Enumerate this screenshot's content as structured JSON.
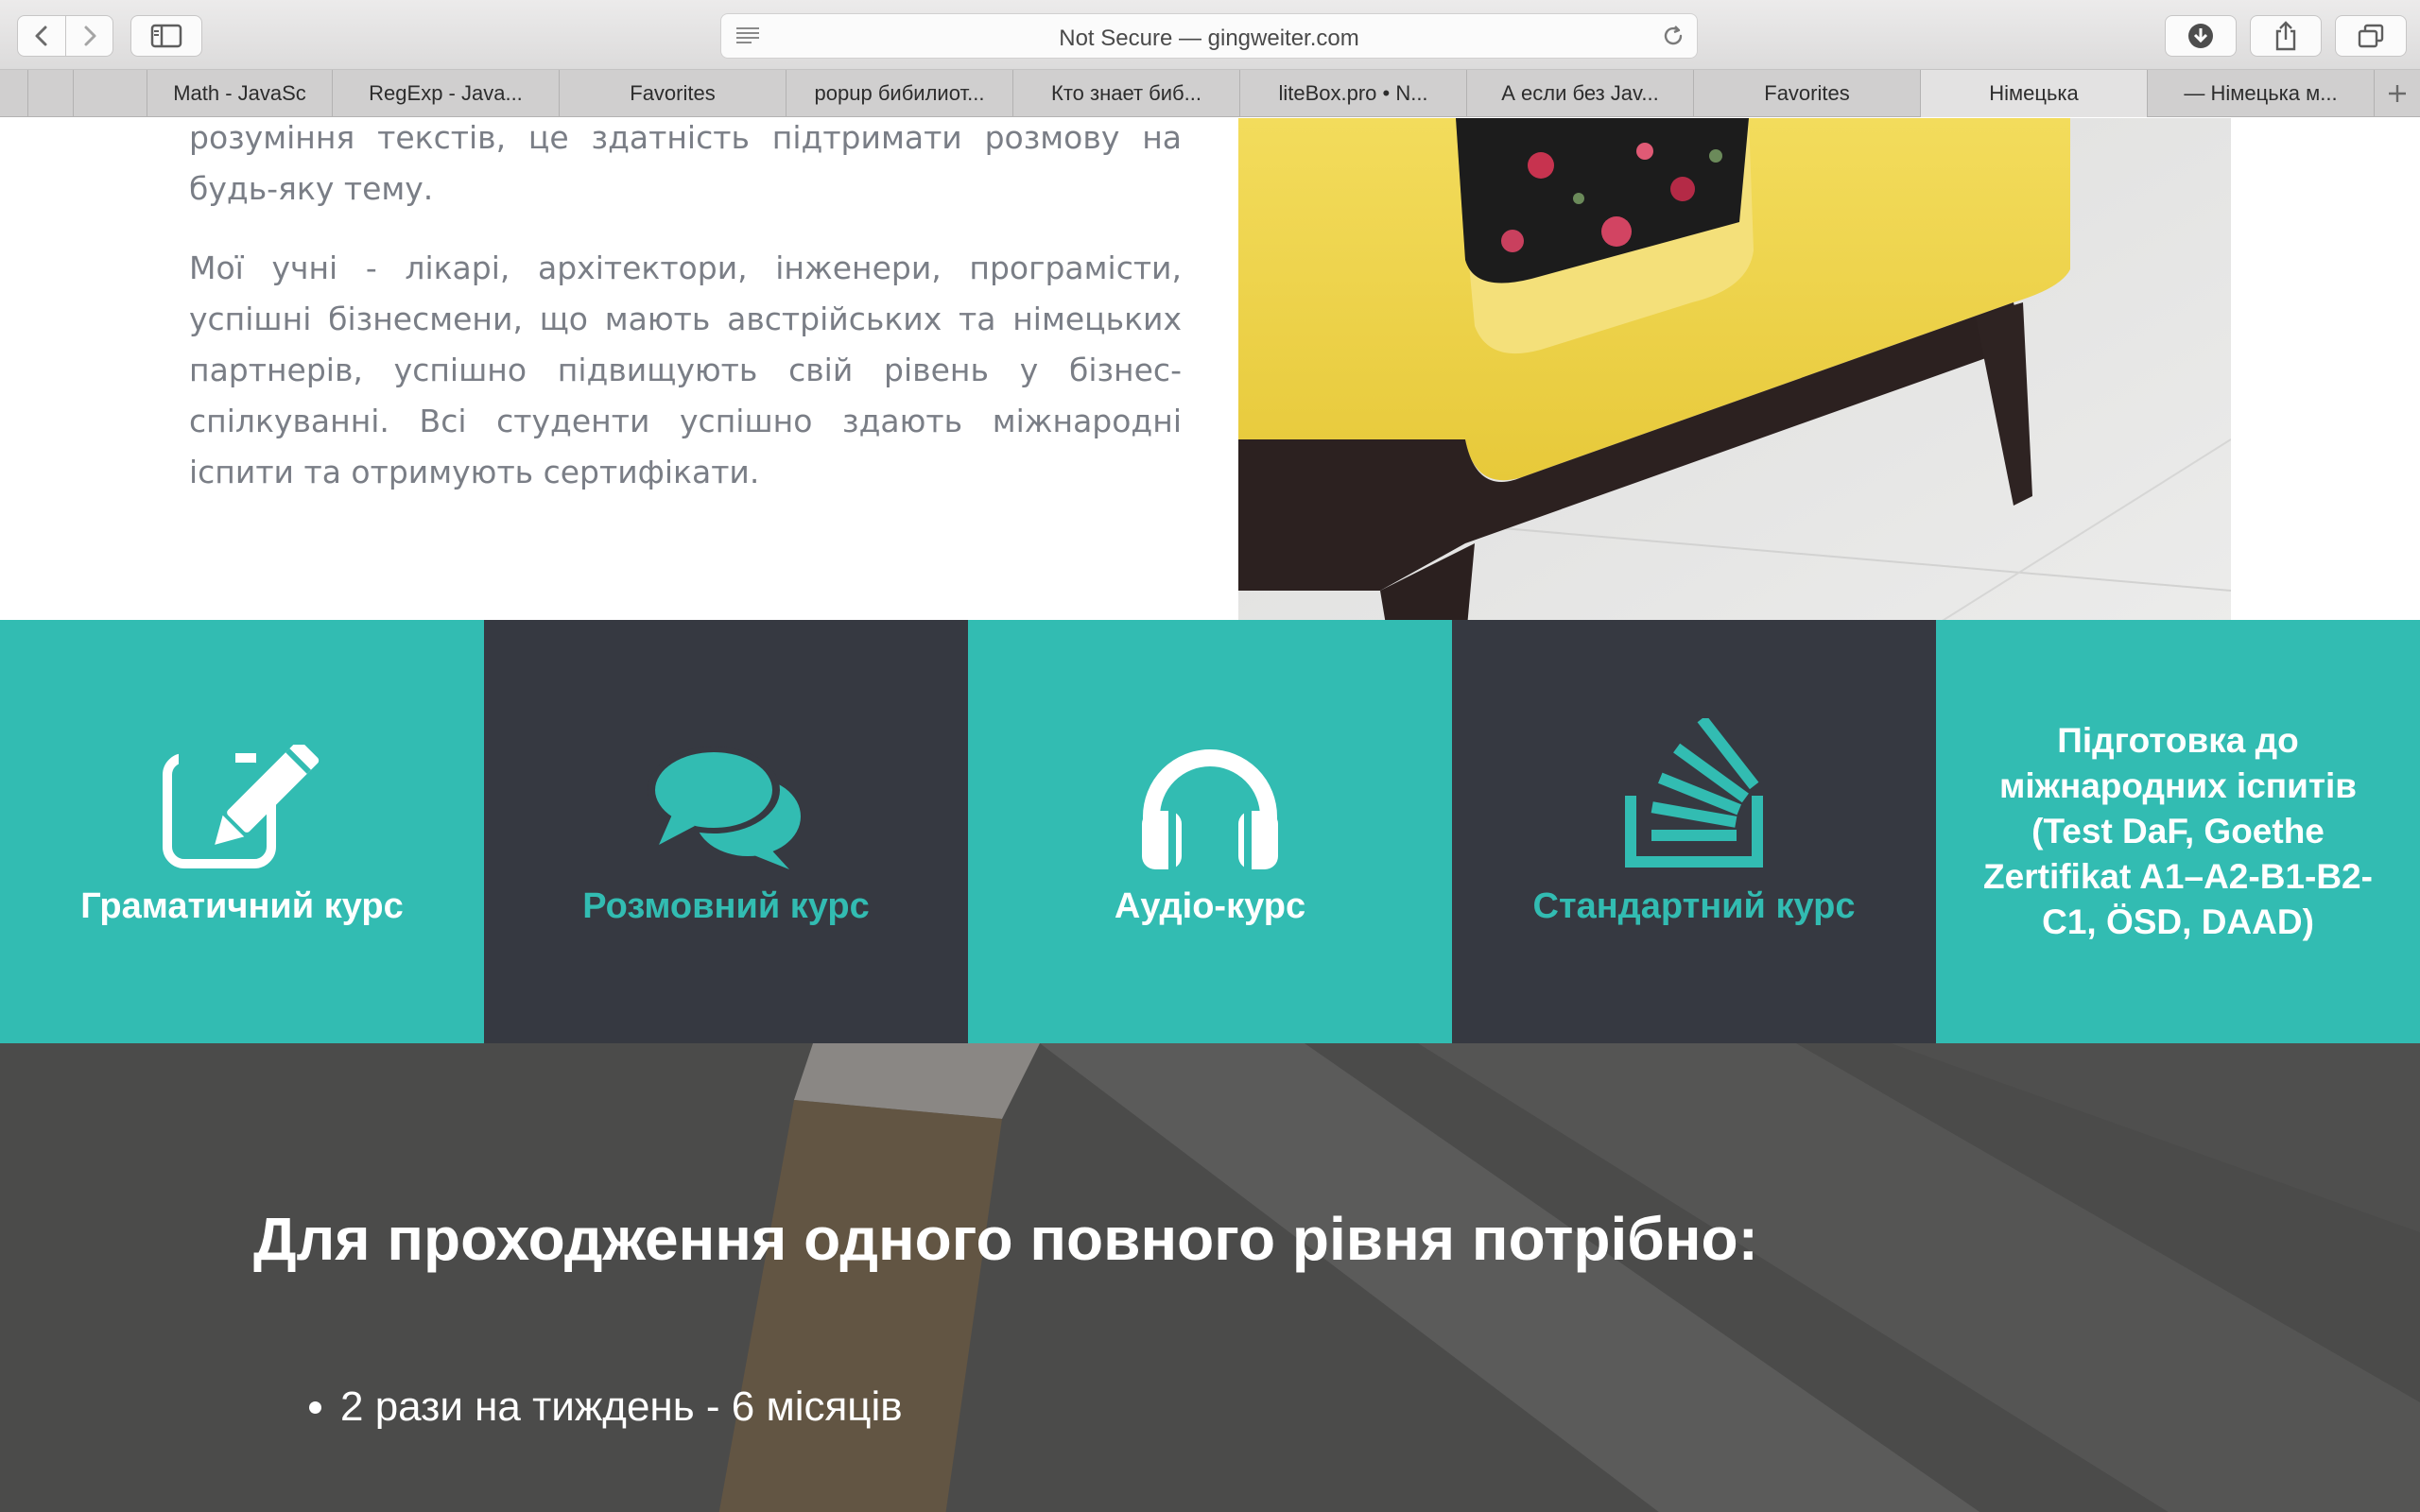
{
  "browser": {
    "address": "Not Secure — gingweiter.com",
    "tabs": [
      {
        "label": "Math - JavaSc",
        "active": false
      },
      {
        "label": "RegExp - Java...",
        "active": false
      },
      {
        "label": "Favorites",
        "active": false
      },
      {
        "label": "popup бибилиот...",
        "active": false
      },
      {
        "label": "Кто знает биб...",
        "active": false
      },
      {
        "label": "liteBox.pro • N...",
        "active": false
      },
      {
        "label": "А если без Jav...",
        "active": false
      },
      {
        "label": "Favorites",
        "active": false
      },
      {
        "label": "Німецька",
        "active": true
      },
      {
        "label": "— Німецька м...",
        "active": false
      }
    ]
  },
  "intro": {
    "paragraph_cut": "розуміння текстів, це здатність підтримати розмову на будь-яку тему.",
    "paragraph_2": "Мої учні - лікарі, архітектори, інженери, програмісти, успішні бізнесмени, що мають австрійських та німецьких партнерів, успішно підвищують свій рівень у бізнес-спілкуванні. Всі студенти успішно здають міжнародні іспити та отримують сертифікати."
  },
  "features": [
    {
      "label": "Граматичний курс",
      "icon": "edit-icon",
      "style": "teal"
    },
    {
      "label": "Розмовний курс",
      "icon": "chat-bubbles-icon",
      "style": "dark"
    },
    {
      "label": "Аудіо-курс",
      "icon": "headphones-icon",
      "style": "teal"
    },
    {
      "label": "Стандартний курс",
      "icon": "stack-overflow-icon",
      "style": "dark"
    },
    {
      "label": "Підготовка до міжнародних іспитів (Test DaF, Goethe Zertifikat A1–A2-B1-B2-C1, ÖSD, DAAD)",
      "icon": null,
      "style": "teal"
    }
  ],
  "level": {
    "title": "Для проходження одного повного рівня потрібно:",
    "items": [
      "2 рази на тиждень - 6 місяців"
    ]
  },
  "colors": {
    "teal": "#32bcb2",
    "dark": "#363941"
  }
}
